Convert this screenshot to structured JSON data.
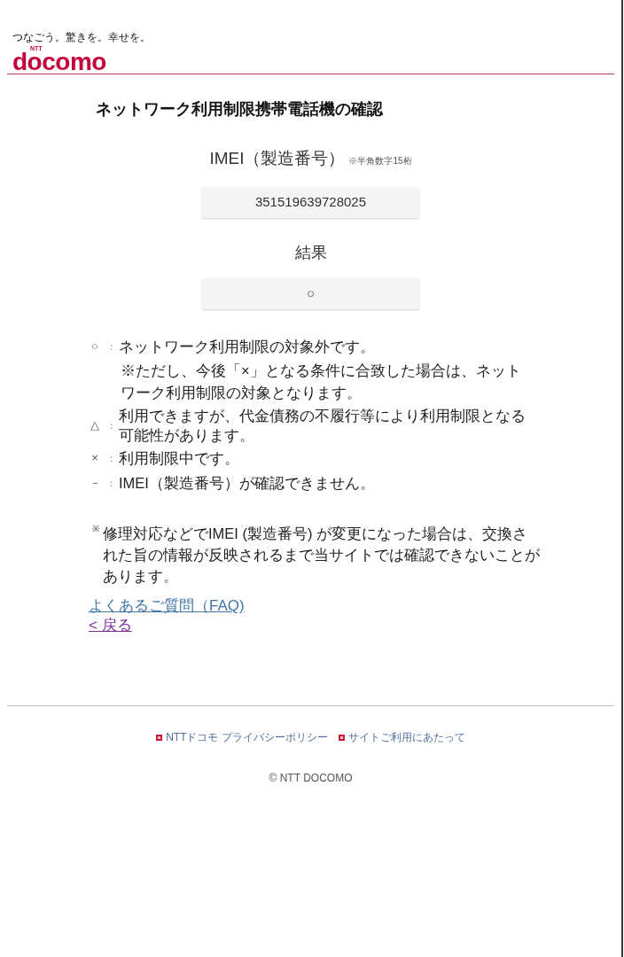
{
  "header": {
    "tagline": "つなごう。驚きを。幸せを。",
    "logo": {
      "mark_text": "NTT",
      "wordmark": "docomo"
    }
  },
  "page_title": "ネットワーク利用制限携帯電話機の確認",
  "imei": {
    "label": "IMEI（製造番号）",
    "hint": "※半角数字15桁",
    "value": "351519639728025"
  },
  "result": {
    "label": "結果",
    "value": "○"
  },
  "legend": [
    {
      "symbol": "○",
      "separator": "：",
      "text": "ネットワーク利用制限の対象外です。",
      "note": "※ただし、今後「×」となる条件に合致した場合は、ネットワーク利用制限の対象となります。"
    },
    {
      "symbol": "△",
      "separator": "：",
      "text": "利用できますが、代金債務の不履行等により利用制限となる可能性があります。"
    },
    {
      "symbol": "×",
      "separator": "：",
      "text": "利用制限中です。"
    },
    {
      "symbol": "－",
      "separator": "：",
      "text": "IMEI（製造番号）が確認できません。"
    }
  ],
  "notice": {
    "mark": "※",
    "text": "修理対応などでIMEI (製造番号) が変更になった場合は、交換された旨の情報が反映されるまで当サイトでは確認できないことがあります。"
  },
  "links": [
    {
      "label": "よくあるご質問（FAQ)",
      "visited": false
    },
    {
      "label": "< 戻る",
      "visited": true
    }
  ],
  "footer": {
    "links": [
      "NTTドコモ プライバシーポリシー",
      "サイトご利用にあたって"
    ],
    "copyright": "© NTT DOCOMO"
  }
}
